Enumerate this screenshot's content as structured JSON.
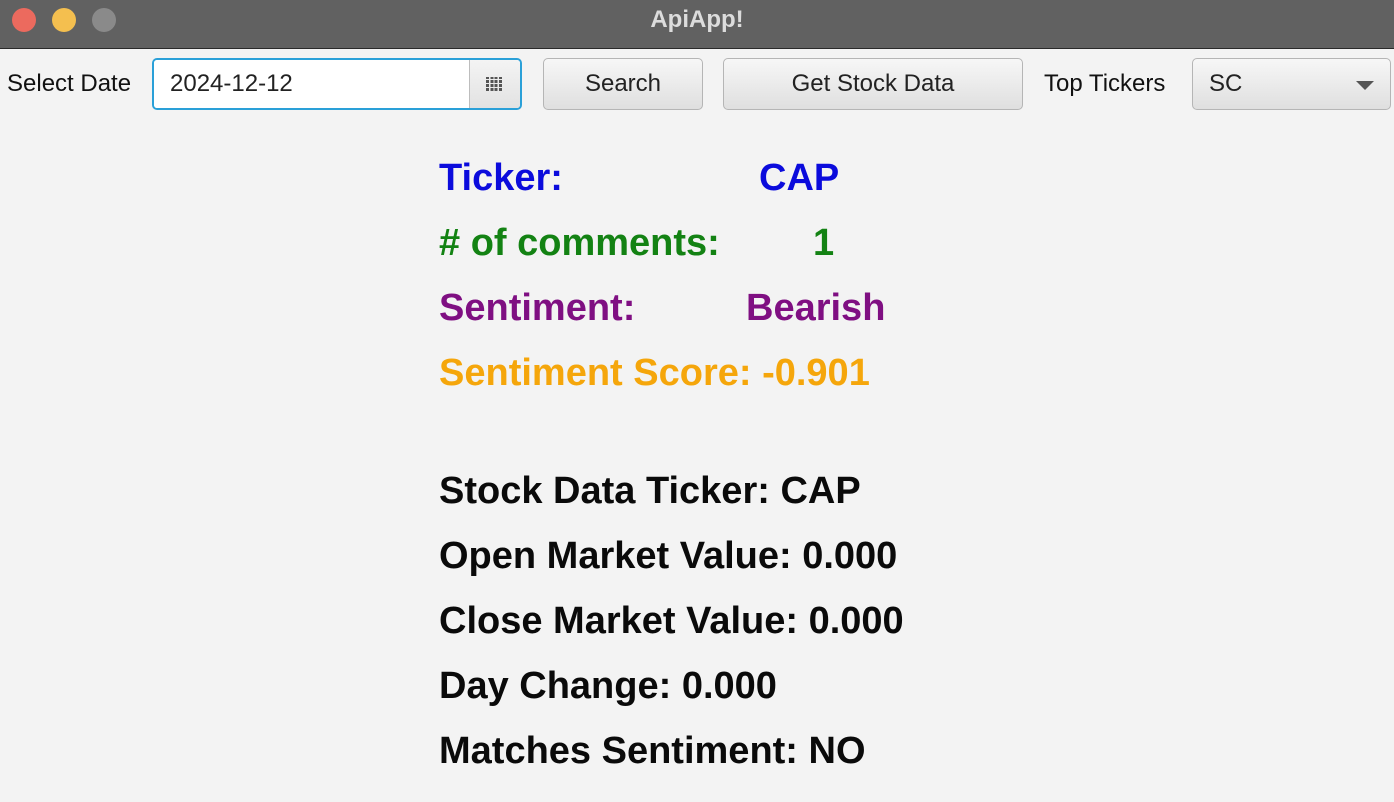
{
  "window": {
    "title": "ApiApp!"
  },
  "toolbar": {
    "select_date_label": "Select Date",
    "date_value": "2024-12-12",
    "search_label": "Search",
    "get_stock_data_label": "Get Stock Data",
    "top_tickers_label": "Top Tickers",
    "top_tickers_selected": "SC"
  },
  "sentiment": {
    "ticker_label": "Ticker:",
    "ticker_value": "CAP",
    "comments_label": "# of comments:",
    "comments_value": "1",
    "sentiment_label": "Sentiment:",
    "sentiment_value": "Bearish",
    "score_text": "Sentiment Score: -0.901"
  },
  "stock": {
    "ticker_line": "Stock Data Ticker: CAP",
    "open_line": "Open Market Value: 0.000",
    "close_line": "Close Market Value: 0.000",
    "day_change_line": "Day Change: 0.000",
    "matches_line": "Matches Sentiment: NO"
  },
  "colors": {
    "ticker": "#0b0bdc",
    "comments": "#138213",
    "sentiment": "#7f0f82",
    "score": "#f5a60b",
    "stock_text": "#0a0a0a",
    "focus_border": "#2aa0d8"
  },
  "icons": {
    "close": "close-window-icon",
    "minimize": "minimize-window-icon",
    "maximize": "maximize-window-icon",
    "calendar": "calendar-icon",
    "dropdown": "chevron-down-icon"
  }
}
